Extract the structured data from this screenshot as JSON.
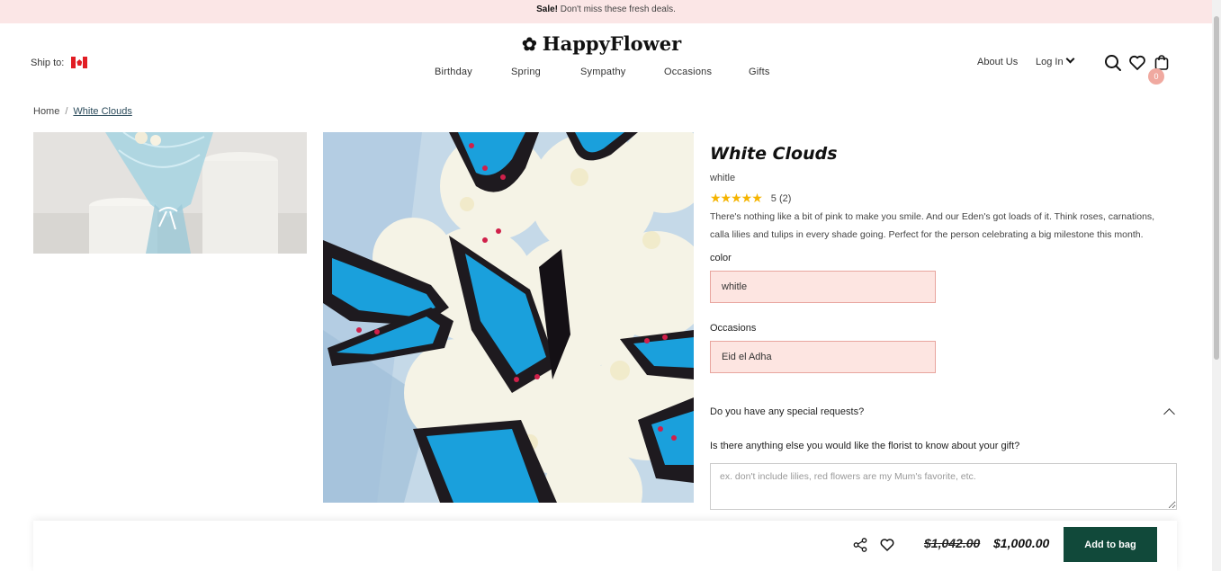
{
  "promo": {
    "bold": "Sale!",
    "text": " Don't miss these fresh deals."
  },
  "header": {
    "ship_label": "Ship to:",
    "flag": "canada-flag",
    "logo_text": "HappyFlower",
    "logo_icon": "flower-icon",
    "nav": [
      "Birthday",
      "Spring",
      "Sympathy",
      "Occasions",
      "Gifts"
    ],
    "about": "About Us",
    "login": "Log In",
    "cart_count": "0"
  },
  "breadcrumb": {
    "home": "Home",
    "sep": "/",
    "current": "White Clouds"
  },
  "product": {
    "title": "White Clouds",
    "subtitle": "whitle",
    "stars": "★★★★★",
    "rating": "5 (2)",
    "description": "There's nothing like a bit of pink to make you smile. And our Eden's got loads of it. Think roses, carnations, calla lilies and tulips in every shade going. Perfect for the person celebrating a big milestone this month.",
    "color_label": "color",
    "color_value": "whitle",
    "occasions_label": "Occasions",
    "occasions_value": "Eid el Adha"
  },
  "requests": {
    "question": "Do you have any special requests?",
    "sub": "Is there anything else you would like the florist to know about your gift?",
    "placeholder": "ex. don't include lilies, red flowers are my Mum's favorite, etc."
  },
  "bottom_bar": {
    "old_price": "$1,042.00",
    "new_price": "$1,000.00",
    "add_label": "Add to bag"
  },
  "colors": {
    "promo_bg": "#fbe6e6",
    "select_bg": "#fde5e1",
    "select_border": "#e8a59f",
    "button": "#11493a",
    "badge": "#f0a9a0",
    "stars": "#f5b400"
  }
}
